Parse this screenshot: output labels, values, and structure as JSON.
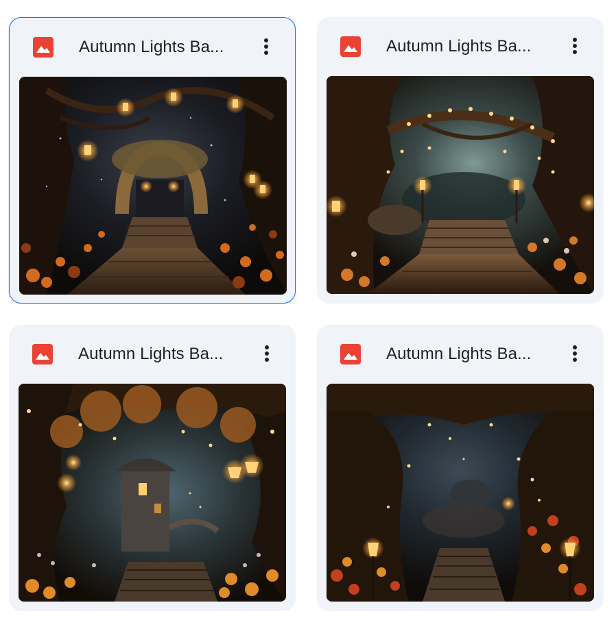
{
  "files": [
    {
      "title": "Autumn Lights Ba...",
      "selected": true,
      "variant": "arch-lanterns"
    },
    {
      "title": "Autumn Lights Ba...",
      "selected": false,
      "variant": "tree-arch-lamps"
    },
    {
      "title": "Autumn Lights Ba...",
      "selected": false,
      "variant": "tower-lanterns"
    },
    {
      "title": "Autumn Lights Ba...",
      "selected": false,
      "variant": "tree-tunnel-lamps"
    }
  ],
  "icons": {
    "file_type": "image-file-icon",
    "more": "more-vert-icon"
  },
  "colors": {
    "file_icon": "#ea4335",
    "selected_border": "#1a73e8",
    "card_bg": "#f0f4f9",
    "title_text": "#1f1f1f"
  }
}
